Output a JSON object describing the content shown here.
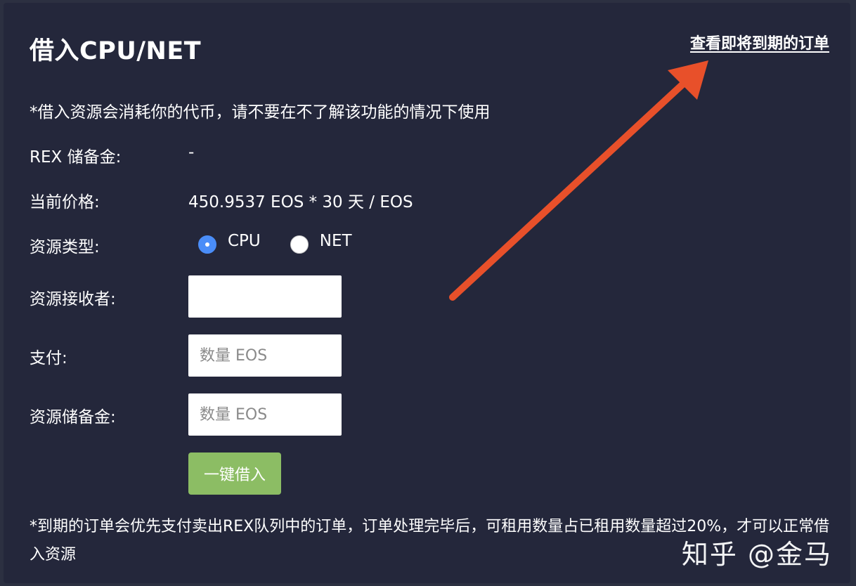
{
  "panel": {
    "title": "借入CPU/NET",
    "orders_link": "查看即将到期的订单",
    "notice": "*借入资源会消耗你的代币，请不要在不了解该功能的情况下使用"
  },
  "rows": {
    "rex_reserve_label": "REX 储备金:",
    "rex_reserve_value": "-",
    "price_label": "当前价格:",
    "price_value": "450.9537 EOS * 30 天 / EOS",
    "resource_type_label": "资源类型:",
    "resource_types": [
      {
        "label": "CPU",
        "selected": true
      },
      {
        "label": "NET",
        "selected": false
      }
    ],
    "receiver_label": "资源接收者:",
    "receiver_value": "",
    "payment_label": "支付:",
    "payment_placeholder": "数量 EOS",
    "reserve_label": "资源储备金:",
    "reserve_placeholder": "数量 EOS"
  },
  "actions": {
    "borrow_label": "一键借入"
  },
  "footnote": "*到期的订单会优先支付卖出REX队列中的订单，订单处理完毕后，可租用数量占已租用数量超过20%，才可以正常借入资源",
  "watermark": "知乎 @金马",
  "colors": {
    "background": "#24273b",
    "button": "#8cbd64",
    "radio_checked": "#4a8df8",
    "arrow": "#e8502a"
  },
  "icons": {
    "annotation": "arrow-icon"
  }
}
